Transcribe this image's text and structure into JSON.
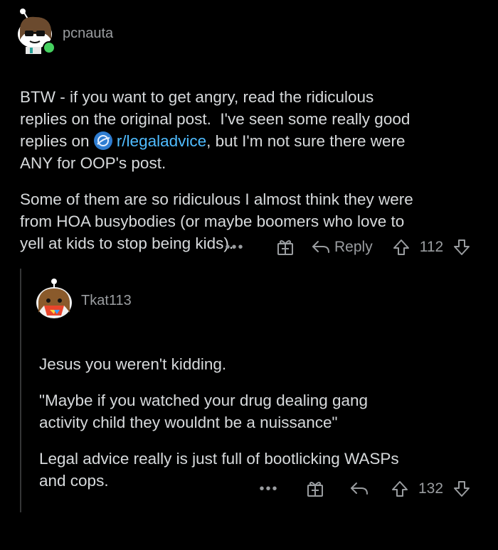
{
  "comments": [
    {
      "username": "pcnauta",
      "body": {
        "p1_part1": "BTW - if you want to get angry, read the ridiculous\nreplies on the original post.  I've seen some really good\nreplies on ",
        "p1_link": "r/legaladvice",
        "p1_part2": ", but I'm not sure there were\nANY for OOP's post.",
        "p2": "Some of them are so ridiculous I almost think they were\nfrom HOA busybodies (or maybe boomers who love to\nyell at kids to stop being kids)."
      },
      "actions": {
        "more": "•••",
        "reply": "Reply",
        "score": "112"
      }
    },
    {
      "username": "Tkat113",
      "body": {
        "p1": "Jesus you weren't kidding.",
        "p2": "\"Maybe if you watched your drug dealing gang\nactivity child they wouldnt be a nuissance\"",
        "p3": "Legal advice really is just full of bootlicking WASPs\nand cops."
      },
      "actions": {
        "more": "•••",
        "score": "132"
      }
    }
  ],
  "colors": {
    "background": "#000000",
    "text": "#d7dadc",
    "meta": "#9a9da0",
    "link": "#4fbcff",
    "online": "#46d160"
  },
  "icons": [
    "avatar-pcnauta",
    "online-indicator",
    "subreddit-icon",
    "more-icon",
    "award-icon",
    "reply-icon",
    "upvote-icon",
    "downvote-icon",
    "avatar-tkat113"
  ]
}
